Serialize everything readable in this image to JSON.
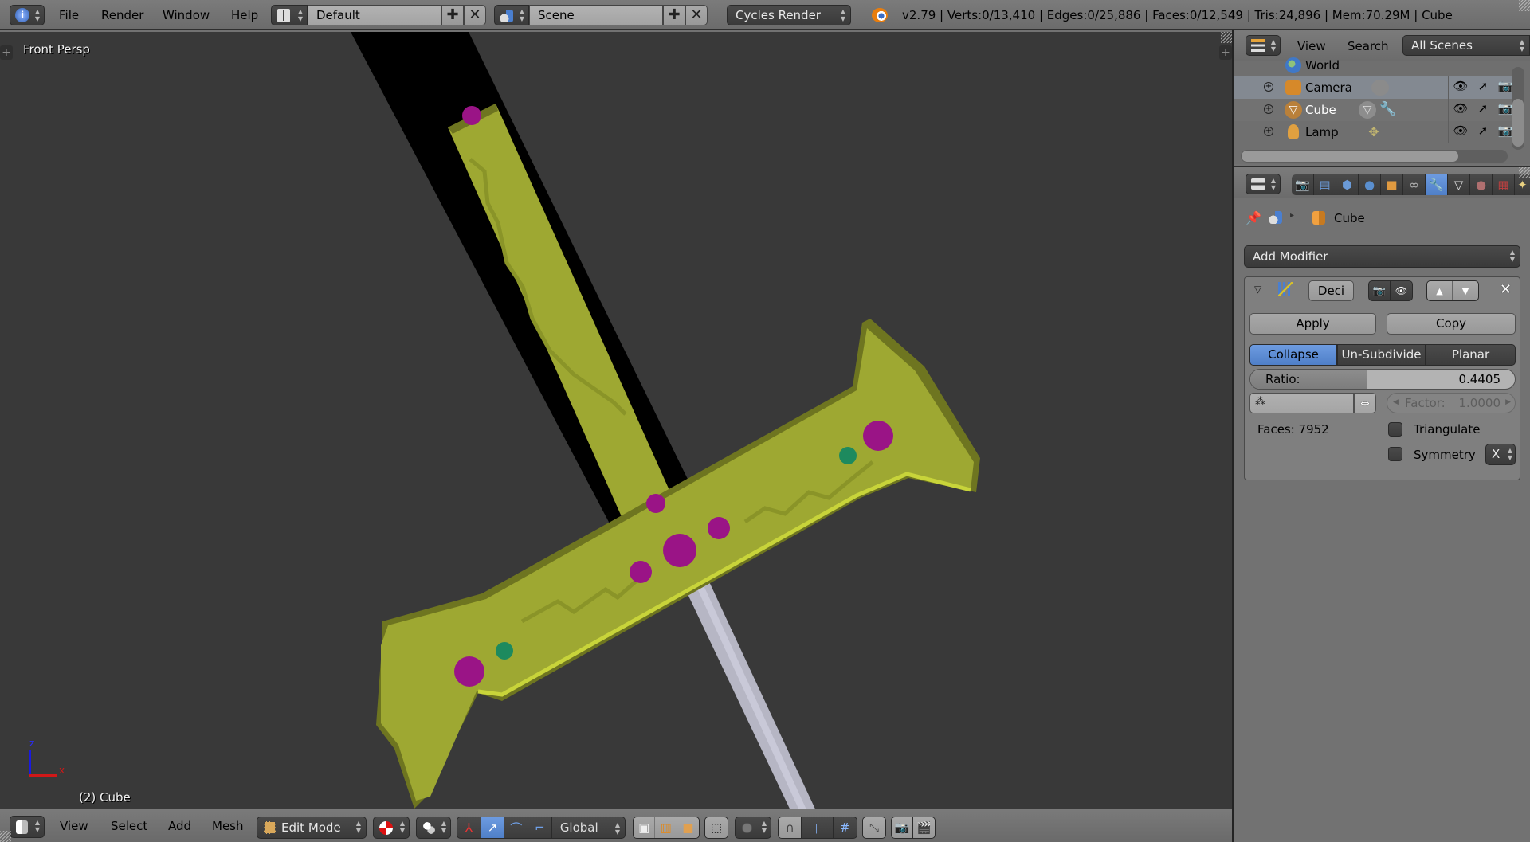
{
  "topbar": {
    "menus": [
      "File",
      "Render",
      "Window",
      "Help"
    ],
    "screen_layout": "Default",
    "scene": "Scene",
    "render_engine": "Cycles Render",
    "stats": "v2.79 | Verts:0/13,410 | Edges:0/25,886 | Faces:0/12,549 | Tris:24,896 | Mem:70.29M | Cube"
  },
  "viewport": {
    "view_label": "Front Persp",
    "object_label": "(2) Cube",
    "axis_x": "x",
    "axis_z": "z",
    "colors": {
      "background": "#393939",
      "guard": "#9ea832",
      "guard_highlight": "#c8d43a",
      "guard_shadow": "#6e7520",
      "blade": "#000000",
      "gem_magenta": "#9a1486",
      "gem_green": "#1d8a5e",
      "handle": "#b9b9c8"
    }
  },
  "bottombar": {
    "menus": [
      "View",
      "Select",
      "Add",
      "Mesh"
    ],
    "mode": "Edit Mode",
    "transform_orientation": "Global"
  },
  "outliner": {
    "menus": [
      "View",
      "Search"
    ],
    "filter": "All Scenes",
    "items": [
      {
        "name": "World",
        "icon": "world-icon"
      },
      {
        "name": "Camera",
        "icon": "camera-object-icon",
        "selected": true
      },
      {
        "name": "Cube",
        "icon": "mesh-object-icon"
      },
      {
        "name": "Lamp",
        "icon": "lamp-object-icon"
      }
    ]
  },
  "properties": {
    "breadcrumb_object": "Cube",
    "add_modifier": "Add Modifier",
    "modifier": {
      "name": "Deci",
      "apply": "Apply",
      "copy": "Copy",
      "modes": [
        "Collapse",
        "Un-Subdivide",
        "Planar"
      ],
      "active_mode": "Collapse",
      "ratio_label": "Ratio:",
      "ratio_value": "0.4405",
      "ratio_fraction": 0.4405,
      "factor_label": "Factor:",
      "factor_value": "1.0000",
      "faces": "Faces: 7952",
      "triangulate": "Triangulate",
      "symmetry": "Symmetry",
      "symmetry_axis": "X",
      "triangulate_checked": false,
      "symmetry_checked": false
    }
  }
}
